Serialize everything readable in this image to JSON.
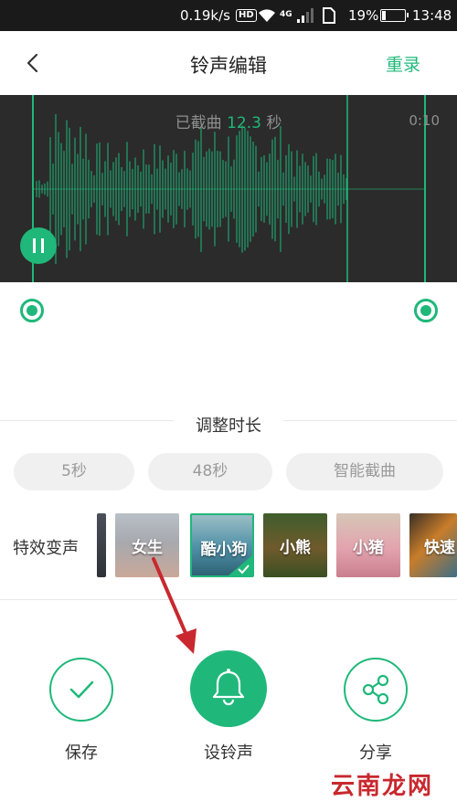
{
  "status_bar": {
    "speed": "0.19k/s",
    "hd": "HD",
    "network": "4G",
    "battery_pct": "19%",
    "battery_level": 0.19,
    "time": "13:48"
  },
  "header": {
    "title": "铃声编辑",
    "redo_label": "重录",
    "back_icon": "chevron-left-icon"
  },
  "waveform": {
    "clip_label": "已截曲",
    "clip_seconds": "12.3",
    "clip_unit": "秒",
    "end_time": "0:10"
  },
  "duration": {
    "title": "调整时长",
    "options": [
      "5秒",
      "48秒",
      "智能截曲"
    ]
  },
  "effects": {
    "label": "特效变声",
    "items": [
      "女生",
      "酷小狗",
      "小熊",
      "小猪",
      "快速"
    ],
    "selected": "酷小狗"
  },
  "actions": {
    "save": "保存",
    "ringtone": "设铃声",
    "share": "分享"
  },
  "watermark": "云南龙网",
  "colors": {
    "accent": "#1fb87a",
    "wave_bg": "#2b2b2b",
    "arrow": "#c8282e"
  }
}
